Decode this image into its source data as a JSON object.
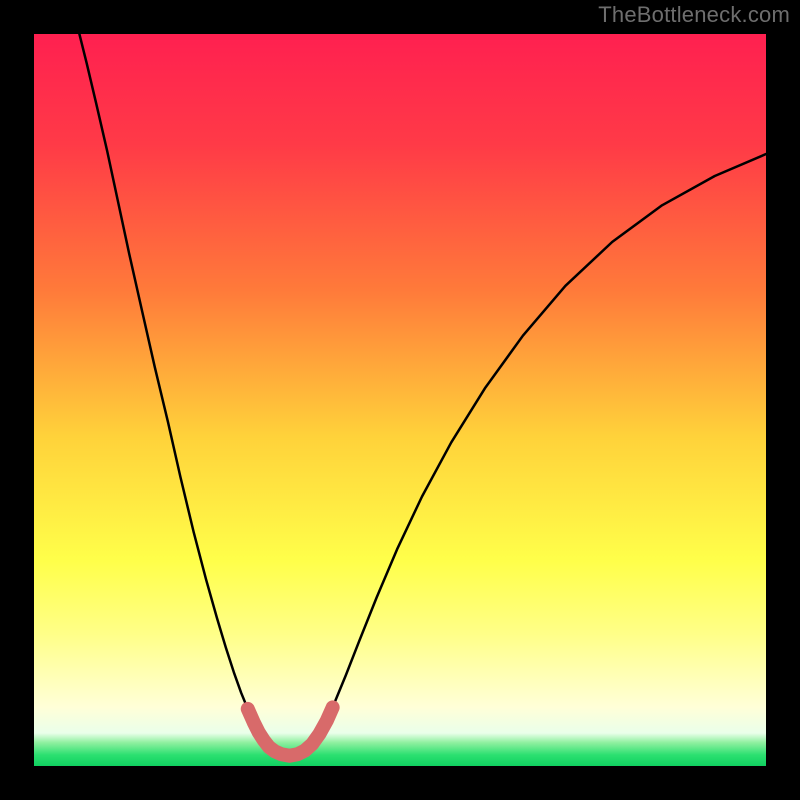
{
  "watermark": "TheBottleneck.com",
  "chart_data": {
    "type": "line",
    "title": "",
    "xlabel": "",
    "ylabel": "",
    "xlim": [
      0,
      1
    ],
    "ylim": [
      0,
      1
    ],
    "gradient_stops": [
      {
        "offset": 0.0,
        "color": "#ff2050"
      },
      {
        "offset": 0.15,
        "color": "#ff3a47"
      },
      {
        "offset": 0.35,
        "color": "#ff7a3a"
      },
      {
        "offset": 0.55,
        "color": "#ffd23a"
      },
      {
        "offset": 0.72,
        "color": "#ffff4a"
      },
      {
        "offset": 0.82,
        "color": "#ffff88"
      },
      {
        "offset": 0.92,
        "color": "#ffffd8"
      },
      {
        "offset": 0.955,
        "color": "#eaffea"
      },
      {
        "offset": 0.968,
        "color": "#8ff0a0"
      },
      {
        "offset": 0.985,
        "color": "#2be070"
      },
      {
        "offset": 1.0,
        "color": "#10d060"
      }
    ],
    "curve_main": [
      [
        0.062,
        1.0
      ],
      [
        0.072,
        0.96
      ],
      [
        0.085,
        0.905
      ],
      [
        0.1,
        0.84
      ],
      [
        0.115,
        0.77
      ],
      [
        0.13,
        0.7
      ],
      [
        0.148,
        0.62
      ],
      [
        0.165,
        0.545
      ],
      [
        0.183,
        0.47
      ],
      [
        0.2,
        0.395
      ],
      [
        0.218,
        0.32
      ],
      [
        0.235,
        0.255
      ],
      [
        0.25,
        0.202
      ],
      [
        0.262,
        0.162
      ],
      [
        0.273,
        0.128
      ],
      [
        0.283,
        0.1
      ],
      [
        0.292,
        0.078
      ],
      [
        0.3,
        0.06
      ],
      [
        0.307,
        0.046
      ],
      [
        0.314,
        0.035
      ],
      [
        0.321,
        0.026
      ],
      [
        0.329,
        0.02
      ],
      [
        0.338,
        0.016
      ],
      [
        0.349,
        0.014
      ],
      [
        0.36,
        0.016
      ],
      [
        0.37,
        0.021
      ],
      [
        0.38,
        0.03
      ],
      [
        0.39,
        0.044
      ],
      [
        0.4,
        0.062
      ],
      [
        0.412,
        0.09
      ],
      [
        0.426,
        0.124
      ],
      [
        0.444,
        0.17
      ],
      [
        0.468,
        0.23
      ],
      [
        0.496,
        0.296
      ],
      [
        0.53,
        0.368
      ],
      [
        0.57,
        0.442
      ],
      [
        0.616,
        0.516
      ],
      [
        0.668,
        0.588
      ],
      [
        0.726,
        0.656
      ],
      [
        0.79,
        0.716
      ],
      [
        0.858,
        0.766
      ],
      [
        0.93,
        0.806
      ],
      [
        1.0,
        0.836
      ]
    ],
    "highlight_segment": [
      [
        0.292,
        0.078
      ],
      [
        0.3,
        0.06
      ],
      [
        0.307,
        0.046
      ],
      [
        0.314,
        0.035
      ],
      [
        0.321,
        0.026
      ],
      [
        0.329,
        0.02
      ],
      [
        0.338,
        0.016
      ],
      [
        0.349,
        0.014
      ],
      [
        0.36,
        0.016
      ],
      [
        0.37,
        0.021
      ],
      [
        0.38,
        0.03
      ],
      [
        0.39,
        0.044
      ],
      [
        0.4,
        0.062
      ],
      [
        0.408,
        0.08
      ]
    ],
    "highlight_color": "#d86a6a",
    "curve_color": "#000000"
  }
}
